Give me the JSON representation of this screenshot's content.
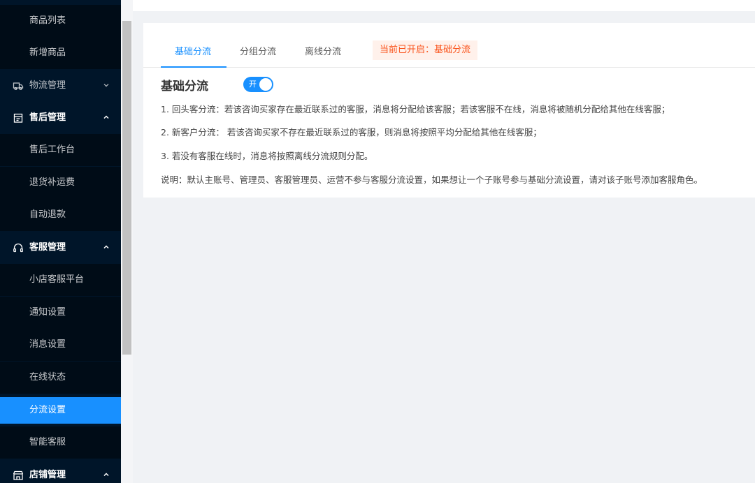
{
  "sidebar": {
    "items": [
      {
        "type": "sub",
        "label": "商品列表"
      },
      {
        "type": "sub",
        "label": "新增商品"
      },
      {
        "type": "group",
        "label": "物流管理",
        "icon": "truck-icon",
        "expanded": false
      },
      {
        "type": "group",
        "label": "售后管理",
        "icon": "clipboard-icon",
        "expanded": true
      },
      {
        "type": "sub",
        "label": "售后工作台"
      },
      {
        "type": "sub",
        "label": "退货补运费"
      },
      {
        "type": "sub",
        "label": "自动退款"
      },
      {
        "type": "group",
        "label": "客服管理",
        "icon": "headset-icon",
        "expanded": true
      },
      {
        "type": "sub",
        "label": "小店客服平台"
      },
      {
        "type": "sub",
        "label": "通知设置"
      },
      {
        "type": "sub",
        "label": "消息设置"
      },
      {
        "type": "sub",
        "label": "在线状态"
      },
      {
        "type": "sub",
        "label": "分流设置",
        "active": true
      },
      {
        "type": "sub",
        "label": "智能客服"
      },
      {
        "type": "group",
        "label": "店铺管理",
        "icon": "store-icon",
        "expanded": true
      }
    ]
  },
  "tabs": [
    {
      "label": "基础分流",
      "active": true
    },
    {
      "label": "分组分流",
      "active": false
    },
    {
      "label": "离线分流",
      "active": false
    }
  ],
  "status_tag": "当前已开启：基础分流",
  "section": {
    "title": "基础分流",
    "switch_label": "开",
    "switch_on": true
  },
  "rules": [
    "1. 回头客分流：若该咨询买家存在最近联系过的客服，消息将分配给该客服；若该客服不在线，消息将被随机分配给其他在线客服；",
    "2. 新客户分流： 若该咨询买家不存在最近联系过的客服，则消息将按照平均分配给其他在线客服；",
    "3. 若没有客服在线时，消息将按照离线分流规则分配。",
    "说明：默认主账号、管理员、客服管理员、运营不参与客服分流设置，如果想让一个子账号参与基础分流设置，请对该子账号添加客服角色。"
  ],
  "colors": {
    "sidebar_bg": "#001529",
    "submenu_bg": "#000c17",
    "accent": "#1890ff",
    "tag_text": "#fa541c",
    "tag_bg": "#fff1eb"
  }
}
